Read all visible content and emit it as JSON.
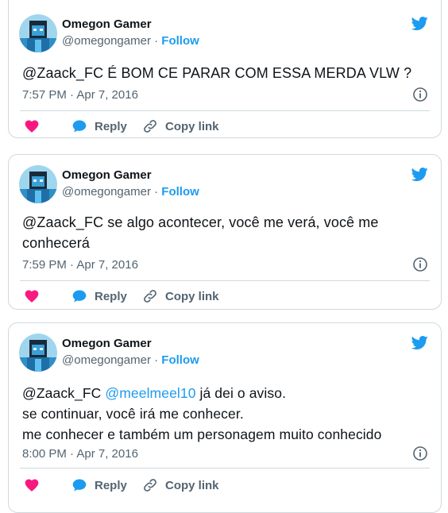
{
  "brand": {
    "accent": "#1d9bf0",
    "like": "#f91880",
    "text": "#0f1419",
    "muted": "#536471"
  },
  "actions": {
    "reply": "Reply",
    "copy": "Copy link"
  },
  "tweets": [
    {
      "author": "Omegon Gamer",
      "handle": "@omegongamer",
      "separator": "·",
      "follow": "Follow",
      "text_mention": "@Zaack_FC",
      "text": " É BOM CE PARAR COM ESSA MERDA VLW ?",
      "time": "7:57 PM · Apr 7, 2016"
    },
    {
      "author": "Omegon Gamer",
      "handle": "@omegongamer",
      "separator": "·",
      "follow": "Follow",
      "text_mention": "@Zaack_FC",
      "text": " se algo acontecer, você me verá, você me\nconhecerá",
      "time": "7:59 PM · Apr 7, 2016"
    },
    {
      "author": "Omegon Gamer",
      "handle": "@omegongamer",
      "separator": "·",
      "follow": "Follow",
      "text_mention": "@Zaack_FC",
      "text_link": "@meelmeel10",
      "text": " já dei o aviso.\nse continuar, você irá me conhecer.\nme conhecer e também um personagem muito conhecido",
      "time": "8:00 PM · Apr 7, 2016"
    }
  ]
}
